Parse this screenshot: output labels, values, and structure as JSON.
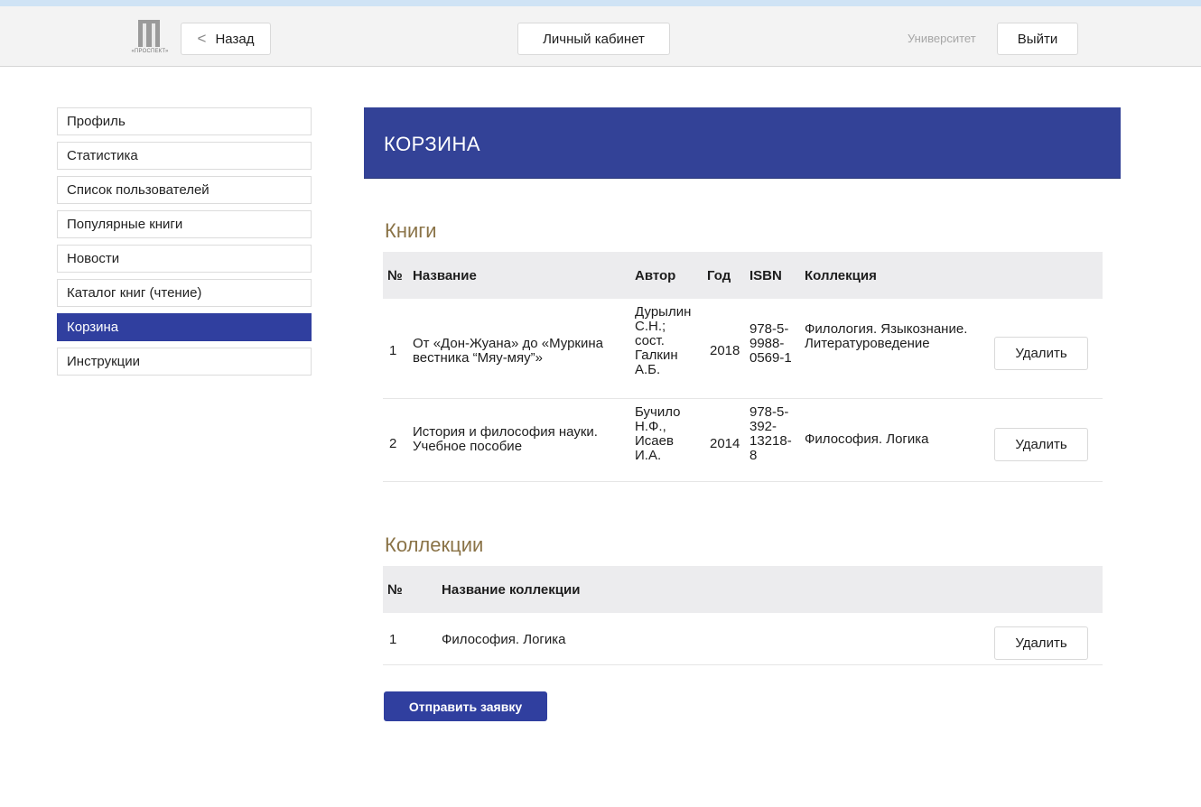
{
  "topbar": {
    "logo_caption": "«ПРОСПЕКТ»",
    "back_label": "Назад",
    "cabinet_label": "Личный кабинет",
    "university_label": "Университет",
    "exit_label": "Выйти"
  },
  "sidebar": {
    "items": [
      {
        "label": "Профиль"
      },
      {
        "label": "Статистика"
      },
      {
        "label": "Список пользователей"
      },
      {
        "label": "Популярные книги"
      },
      {
        "label": "Новости"
      },
      {
        "label": "Каталог книг (чтение)"
      },
      {
        "label": "Корзина",
        "active": true
      },
      {
        "label": "Инструкции"
      }
    ]
  },
  "page": {
    "title": "КОРЗИНА"
  },
  "books": {
    "title": "Книги",
    "headers": {
      "num": "№",
      "name": "Название",
      "author": "Автор",
      "year": "Год",
      "isbn": "ISBN",
      "collection": "Коллекция"
    },
    "rows": [
      {
        "num": "1",
        "name": "От «Дон-Жуана» до «Муркина вестника “Мяу-мяу”»",
        "author": "Дурылин С.Н.; сост. Галкин А.Б.",
        "year": "2018",
        "isbn": "978-5-9988-0569-1",
        "collection": "Филология. Языкознание. Литературоведение",
        "delete_label": "Удалить"
      },
      {
        "num": "2",
        "name": "История и философия науки. Учебное пособие",
        "author": "Бучило Н.Ф., Исаев И.А.",
        "year": "2014",
        "isbn": "978-5-392-13218-8",
        "collection": "Философия. Логика",
        "delete_label": "Удалить"
      }
    ]
  },
  "collections": {
    "title": "Коллекции",
    "headers": {
      "num": "№",
      "name": "Название коллекции"
    },
    "rows": [
      {
        "num": "1",
        "name": "Философия. Логика",
        "delete_label": "Удалить"
      }
    ]
  },
  "submit_label": "Отправить заявку"
}
